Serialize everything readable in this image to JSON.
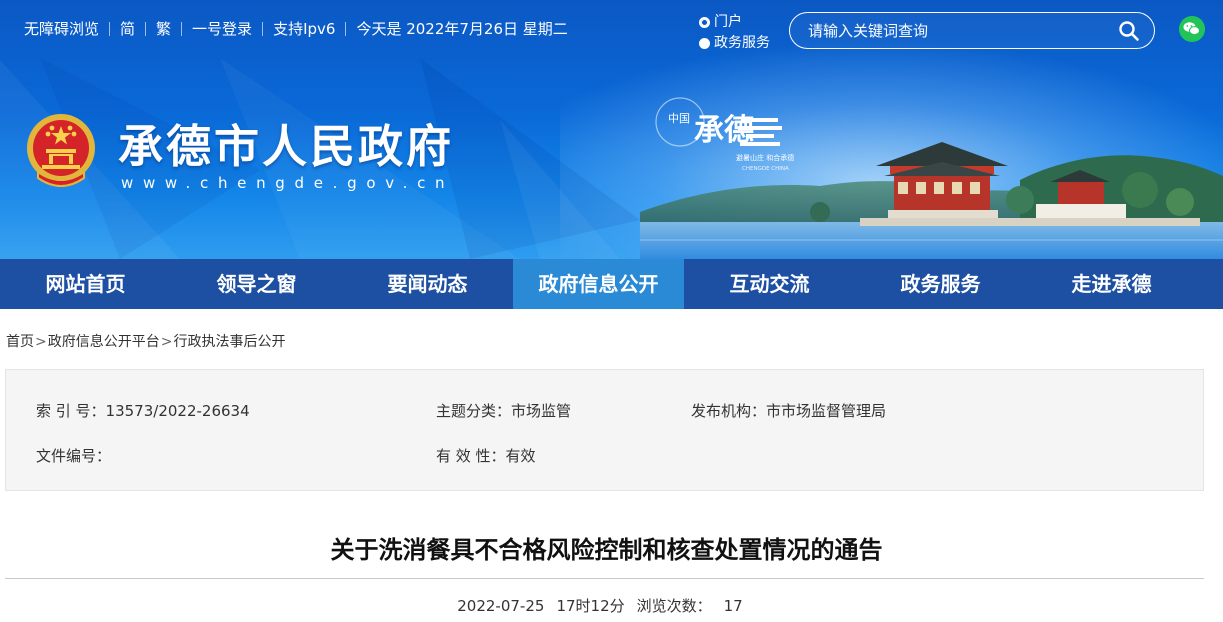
{
  "topbar": {
    "links": [
      "无障碍浏览",
      "简",
      "繁",
      "一号登录",
      "支持Ipv6"
    ],
    "date_text": "今天是 2022年7月26日 星期二",
    "scope_options": [
      "门户",
      "政务服务"
    ],
    "search_placeholder": "请输入关键词查询"
  },
  "header": {
    "site_name": "承德市人民政府",
    "site_url": "www.chengde.gov.cn",
    "logo_text": {
      "main": "承德",
      "sub": "中国",
      "slogan": "避暑山庄  和合承德",
      "en": "CHENGDE CHINA"
    }
  },
  "nav": {
    "items": [
      "网站首页",
      "领导之窗",
      "要闻动态",
      "政府信息公开",
      "互动交流",
      "政务服务",
      "走进承德"
    ],
    "active_index": 3
  },
  "breadcrumb": [
    "首页",
    "政府信息公开平台",
    "行政执法事后公开"
  ],
  "info": {
    "index_label": "索 引 号：",
    "index_value": "13573/2022-26634",
    "topic_label": "主题分类：",
    "topic_value": "市场监管",
    "org_label": "发布机构：",
    "org_value": "市市场监督管理局",
    "docno_label": "文件编号：",
    "docno_value": "",
    "validity_label": "有 效 性：",
    "validity_value": "有效"
  },
  "article": {
    "title": "关于洗消餐具不合格风险控制和核查处置情况的通告",
    "date": "2022-07-25",
    "time": "17时12分",
    "views_label": "浏览次数：",
    "views": "17"
  },
  "colors": {
    "banner_blue": "#0b58c4",
    "nav_blue": "#1d4fa3",
    "nav_active": "#2b8ad6",
    "wechat_green": "#22c45a"
  },
  "icons": [
    "search-icon",
    "wechat-icon",
    "national-emblem-icon"
  ]
}
